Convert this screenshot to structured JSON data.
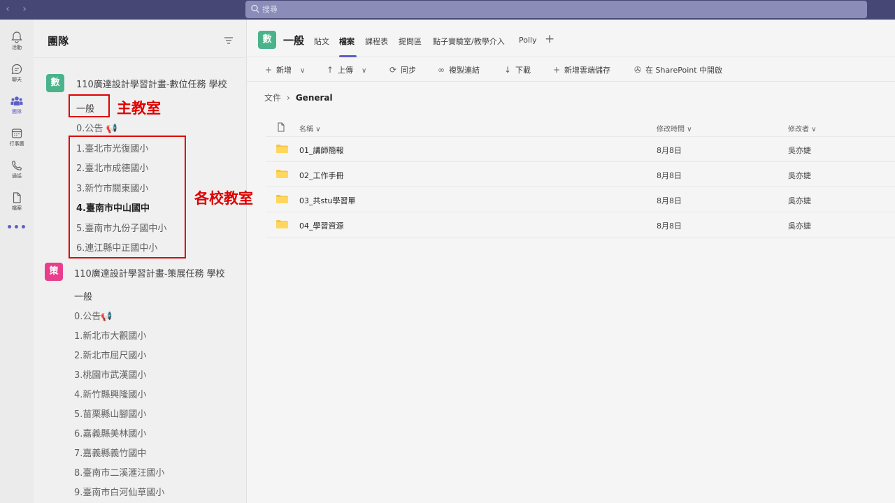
{
  "search": {
    "placeholder": "搜尋"
  },
  "rail": {
    "items": [
      {
        "label": "活動",
        "icon": "bell-icon"
      },
      {
        "label": "聊天",
        "icon": "chat-icon"
      },
      {
        "label": "團隊",
        "icon": "teams-icon"
      },
      {
        "label": "行事曆",
        "icon": "calendar-icon"
      },
      {
        "label": "通話",
        "icon": "phone-icon"
      },
      {
        "label": "檔案",
        "icon": "file-icon"
      }
    ],
    "more": "•••"
  },
  "panel": {
    "title": "團隊",
    "teams": [
      {
        "avatar": "數",
        "avatar_color": "#4bb38b",
        "name": "110廣達設計學習計畫-數位任務 學校",
        "channels": [
          "一般",
          "0.公告 📢",
          "1.臺北市光復國小",
          "2.臺北市成德國小",
          "3.新竹市關東國小",
          "4.臺南市中山國中",
          "5.臺南市九份子國中小",
          "6.連江縣中正國中小"
        ]
      },
      {
        "avatar": "策",
        "avatar_color": "#e83e8c",
        "name": "110廣達設計學習計畫-策展任務 學校",
        "channels": [
          "一般",
          "0.公告📢",
          "1.新北市大觀國小",
          "2.新北市屈尺國小",
          "3.桃園市武漢國小",
          "4.新竹縣興隆國小",
          "5.苗栗縣山腳國小",
          "6.嘉義縣美林國小",
          "7.嘉義縣義竹國中",
          "8.臺南市二溪滙汪國小",
          "9.臺南市白河仙草國小"
        ]
      }
    ]
  },
  "annotations": {
    "main_classroom": "主教室",
    "school_classrooms": "各校教室"
  },
  "header": {
    "avatar": "數",
    "title": "一般",
    "tabs": [
      "貼文",
      "檔案",
      "課程表",
      "提問區",
      "點子實驗室/教學介入",
      "Polly"
    ],
    "active_tab": "檔案"
  },
  "toolbar": {
    "new": "新增",
    "upload": "上傳",
    "sync": "同步",
    "copy_link": "複製連結",
    "download": "下載",
    "add_cloud": "新增雲端儲存",
    "open_sharepoint": "在 SharePoint 中開啟"
  },
  "breadcrumb": {
    "root": "文件",
    "current": "General"
  },
  "files": {
    "columns": {
      "name": "名稱",
      "modified": "修改時間",
      "modified_by": "修改者"
    },
    "rows": [
      {
        "name": "01_講師簡報",
        "modified": "8月8日",
        "modified_by": "吳亦婕"
      },
      {
        "name": "02_工作手冊",
        "modified": "8月8日",
        "modified_by": "吳亦婕"
      },
      {
        "name": "03_共stu學習單",
        "modified": "8月8日",
        "modified_by": "吳亦婕"
      },
      {
        "name": "04_學習資源",
        "modified": "8月8日",
        "modified_by": "吳亦婕"
      }
    ]
  }
}
